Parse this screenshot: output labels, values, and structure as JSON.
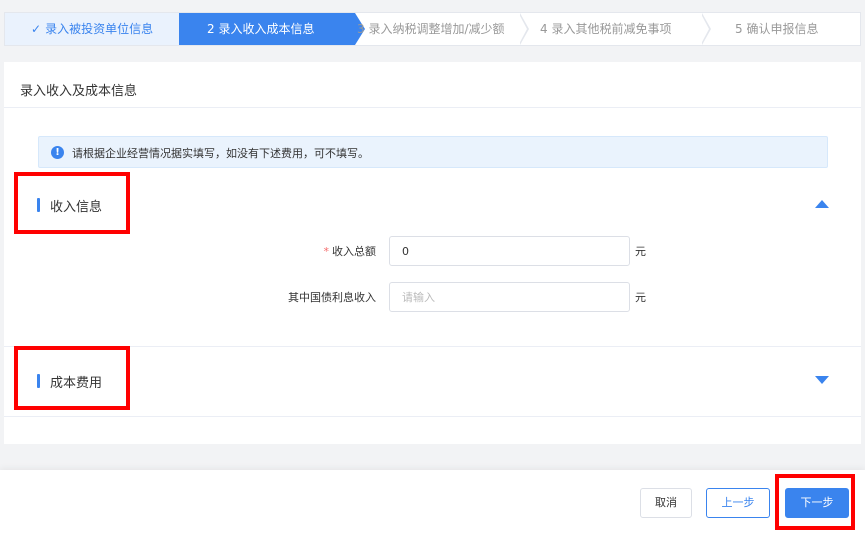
{
  "steps": [
    {
      "label": "录入被投资单位信息",
      "check": "✓"
    },
    {
      "label": "2  录入收入成本信息"
    },
    {
      "label": "3  录入纳税调整增加/减少额"
    },
    {
      "label": "4  录入其他税前减免事项"
    },
    {
      "label": "5  确认申报信息"
    }
  ],
  "card": {
    "title": "录入收入及成本信息",
    "notice": "请根据企业经营情况据实填写，如没有下述费用，可不填写。",
    "notice_icon": "!"
  },
  "income_section": {
    "label": "收入信息",
    "fields": [
      {
        "required_mark": "*",
        "label": "收入总额",
        "value": "0",
        "placeholder": "",
        "unit": "元"
      },
      {
        "required_mark": "",
        "label": "其中国债利息收入",
        "value": "",
        "placeholder": "请输入",
        "unit": "元"
      }
    ]
  },
  "cost_section": {
    "label": "成本费用"
  },
  "footer": {
    "cancel_label": "取消",
    "prev_label": "上一步",
    "next_label": "下一步"
  },
  "colors": {
    "accent": "#3a84ee",
    "highlight": "#ff0000",
    "required": "#f56c6c"
  },
  "icons": {
    "info": "info-icon",
    "collapse": "chevron-up-icon",
    "expand": "chevron-down-icon"
  }
}
